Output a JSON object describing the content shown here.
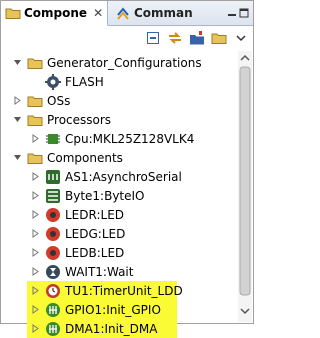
{
  "tabs": [
    {
      "label": "Compone",
      "close": "✕",
      "active": true
    },
    {
      "label": "Comman",
      "active": false
    }
  ],
  "tree": [
    {
      "label": "Generator_Configurations"
    },
    {
      "label": "FLASH"
    },
    {
      "label": "OSs"
    },
    {
      "label": "Processors"
    },
    {
      "label": "Cpu:MKL25Z128VLK4"
    },
    {
      "label": "Components"
    },
    {
      "label": "AS1:AsynchroSerial"
    },
    {
      "label": "Byte1:ByteIO"
    },
    {
      "label": "LEDR:LED"
    },
    {
      "label": "LEDG:LED"
    },
    {
      "label": "LEDB:LED"
    },
    {
      "label": "WAIT1:Wait"
    },
    {
      "label": "TU1:TimerUnit_LDD"
    },
    {
      "label": "GPIO1:Init_GPIO"
    },
    {
      "label": "DMA1:Init_DMA"
    }
  ],
  "colors": {
    "highlight": "#fafa35",
    "folder": "#e8c35a",
    "component_green": "#3a8a2a",
    "led_red": "#d43a2a"
  }
}
